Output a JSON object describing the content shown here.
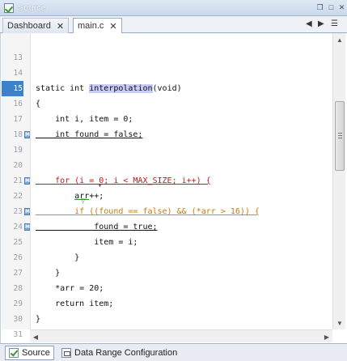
{
  "window": {
    "title": "Source"
  },
  "tabs": [
    {
      "label": "Dashboard",
      "close": "✕"
    },
    {
      "label": "main.c",
      "close": "✕"
    }
  ],
  "nav": {
    "prev": "◀",
    "next": "▶",
    "menu": "☰"
  },
  "editor": {
    "current_line": 15,
    "lines": [
      {
        "n": "13",
        "code": ""
      },
      {
        "n": "14",
        "code": ""
      },
      {
        "n": "15",
        "code": "static int interpolation(void)",
        "pre": "static int ",
        "sel": "interpolation",
        "post": "(void)"
      },
      {
        "n": "16",
        "code": "{"
      },
      {
        "n": "17",
        "code": "    int i, item = 0;"
      },
      {
        "n": "18",
        "code": "    int found = false;",
        "marker": "M"
      },
      {
        "n": "19",
        "code": ""
      },
      {
        "n": "20",
        "code": ""
      },
      {
        "n": "21",
        "code": "    for (i = 0; i < MAX_SIZE; i++) {",
        "marker": "M"
      },
      {
        "n": "22",
        "code": "        arr++;",
        "p1": "arr",
        "p2": "++;"
      },
      {
        "n": "23",
        "code": "        if ((found == false) && (*arr > 16)) {",
        "marker": "M"
      },
      {
        "n": "24",
        "code": "            found = true;",
        "marker": "M"
      },
      {
        "n": "25",
        "code": "            item = i;"
      },
      {
        "n": "26",
        "code": "        }"
      },
      {
        "n": "27",
        "code": "    }"
      },
      {
        "n": "28",
        "code": "    *arr = 20;"
      },
      {
        "n": "29",
        "code": "    return item;"
      },
      {
        "n": "30",
        "code": "}"
      },
      {
        "n": "31",
        "code": ""
      }
    ]
  },
  "bottom_tabs": [
    {
      "label": "Source"
    },
    {
      "label": "Data Range Configuration"
    }
  ],
  "colors": {
    "accent": "#3d82c8",
    "error": "#c41616",
    "warning": "#c87a00",
    "selection": "#c9cdf7"
  }
}
